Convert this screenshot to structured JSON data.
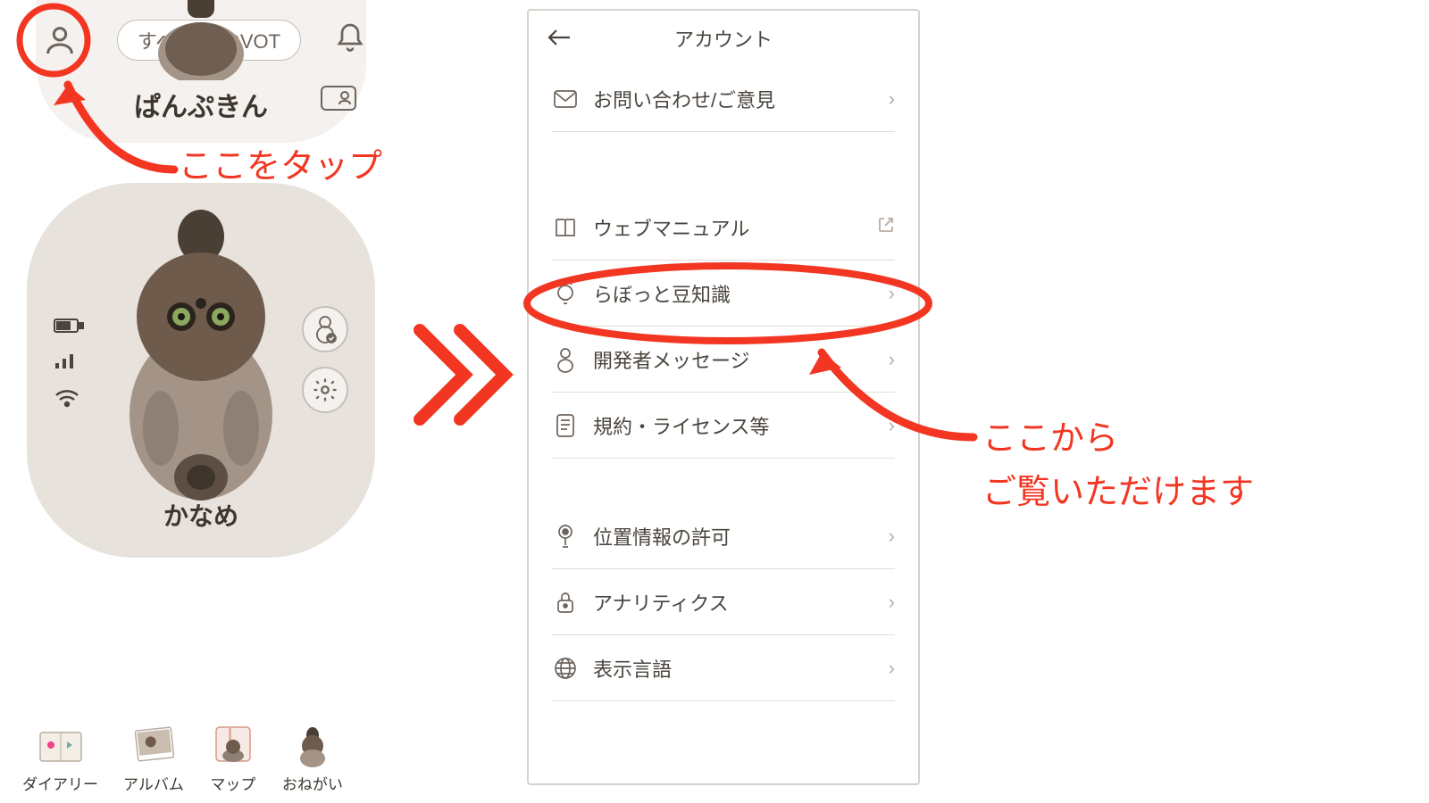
{
  "home": {
    "all_lovot_pill": "すべてのLOVOT",
    "robot_top_name": "ぱんぷきん",
    "robot_card_name": "かなめ",
    "nav": [
      {
        "label": "ダイアリー",
        "icon": "diary-icon"
      },
      {
        "label": "アルバム",
        "icon": "album-icon"
      },
      {
        "label": "マップ",
        "icon": "map-icon"
      },
      {
        "label": "おねがい",
        "icon": "request-icon"
      }
    ]
  },
  "account": {
    "title": "アカウント",
    "items": [
      {
        "label": "お問い合わせ/ご意見",
        "icon": "mail-icon",
        "chev": "›"
      },
      {
        "label": "ウェブマニュアル",
        "icon": "book-icon",
        "chev": "↗"
      },
      {
        "label": "らぼっと豆知識",
        "icon": "bulb-icon",
        "chev": "›"
      },
      {
        "label": "開発者メッセージ",
        "icon": "dev-icon",
        "chev": "›"
      },
      {
        "label": "規約・ライセンス等",
        "icon": "terms-icon",
        "chev": "›"
      },
      {
        "label": "位置情報の許可",
        "icon": "location-icon",
        "chev": "›"
      },
      {
        "label": "アナリティクス",
        "icon": "lock-icon",
        "chev": "›"
      },
      {
        "label": "表示言語",
        "icon": "globe-icon",
        "chev": "›"
      }
    ]
  },
  "annotation": {
    "tap_here": "ここをタップ",
    "view_from_here_l1": "ここから",
    "view_from_here_l2": "ご覧いただけます"
  },
  "colors": {
    "accent_red": "#f23622"
  }
}
